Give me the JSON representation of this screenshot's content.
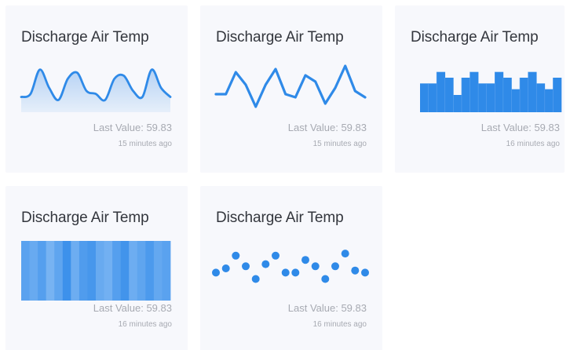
{
  "accent_color": "#2f8ae8",
  "cards": [
    {
      "title": "Discharge Air Temp",
      "last_value": "Last Value: 59.83",
      "time_ago": "15 minutes ago"
    },
    {
      "title": "Discharge Air Temp",
      "last_value": "Last Value: 59.83",
      "time_ago": "15 minutes ago"
    },
    {
      "title": "Discharge Air Temp",
      "last_value": "Last Value: 59.83",
      "time_ago": "16 minutes ago"
    },
    {
      "title": "Discharge Air Temp",
      "last_value": "Last Value: 59.83",
      "time_ago": "16 minutes ago"
    },
    {
      "title": "Discharge Air Temp",
      "last_value": "Last Value: 59.83",
      "time_ago": "16 minutes ago"
    }
  ],
  "chart_data": [
    {
      "type": "area",
      "values": [
        58,
        60,
        76,
        64,
        56,
        70,
        74,
        62,
        60,
        56,
        70,
        72,
        62,
        58,
        76,
        64,
        58
      ],
      "ylim": [
        50,
        80
      ]
    },
    {
      "type": "line",
      "values": [
        60,
        60,
        74,
        66,
        52,
        66,
        76,
        60,
        58,
        72,
        68,
        54,
        64,
        78,
        62,
        58
      ],
      "ylim": [
        50,
        80
      ]
    },
    {
      "type": "bar",
      "values": [
        60,
        60,
        64,
        62,
        56,
        62,
        64,
        60,
        60,
        64,
        62,
        58,
        62,
        64,
        60,
        58,
        62
      ],
      "ylim": [
        50,
        68
      ]
    },
    {
      "type": "heatmap",
      "values": [
        0.5,
        0.35,
        0.55,
        0.2,
        0.45,
        0.8,
        0.3,
        0.6,
        0.7,
        0.35,
        0.25,
        0.55,
        0.75,
        0.3,
        0.45,
        0.65,
        0.4,
        0.5
      ]
    },
    {
      "type": "scatter",
      "values": [
        63,
        65,
        71,
        66,
        60,
        67,
        71,
        63,
        63,
        69,
        66,
        60,
        66,
        72,
        64,
        63
      ],
      "ylim": [
        55,
        75
      ]
    }
  ]
}
